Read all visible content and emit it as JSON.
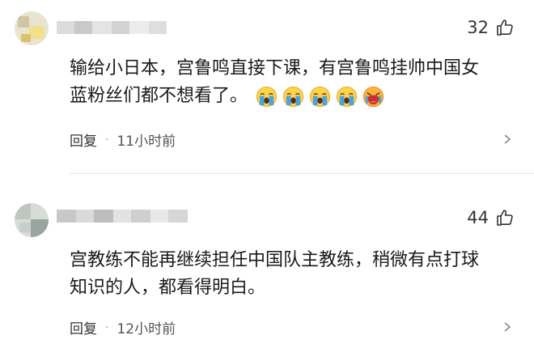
{
  "comments": [
    {
      "likes": "32",
      "lines": [
        "输给小日本，宫鲁鸣直接下课，有宫鲁鸣挂帅中国女",
        "蓝粉丝们都不想看了。"
      ],
      "emojis": [
        "crying-emoji",
        "crying-emoji",
        "crying-emoji",
        "crying-emoji",
        "loud-crying-emoji"
      ],
      "reply_label": "回复",
      "separator": "·",
      "time": "11小时前"
    },
    {
      "likes": "44",
      "lines": [
        "宫教练不能再继续担任中国队主教练，稍微有点打球",
        "知识的人，都看得明白。"
      ],
      "emojis": [],
      "reply_label": "回复",
      "separator": "·",
      "time": "12小时前"
    }
  ],
  "colors": {
    "text": "#1a1a1a",
    "meta": "#555555",
    "emoji_face": "#4aa3df",
    "emoji_red_face": "#e8453c"
  },
  "icons": {
    "like": "thumbs-up-icon",
    "more": "chevron-right-icon"
  }
}
